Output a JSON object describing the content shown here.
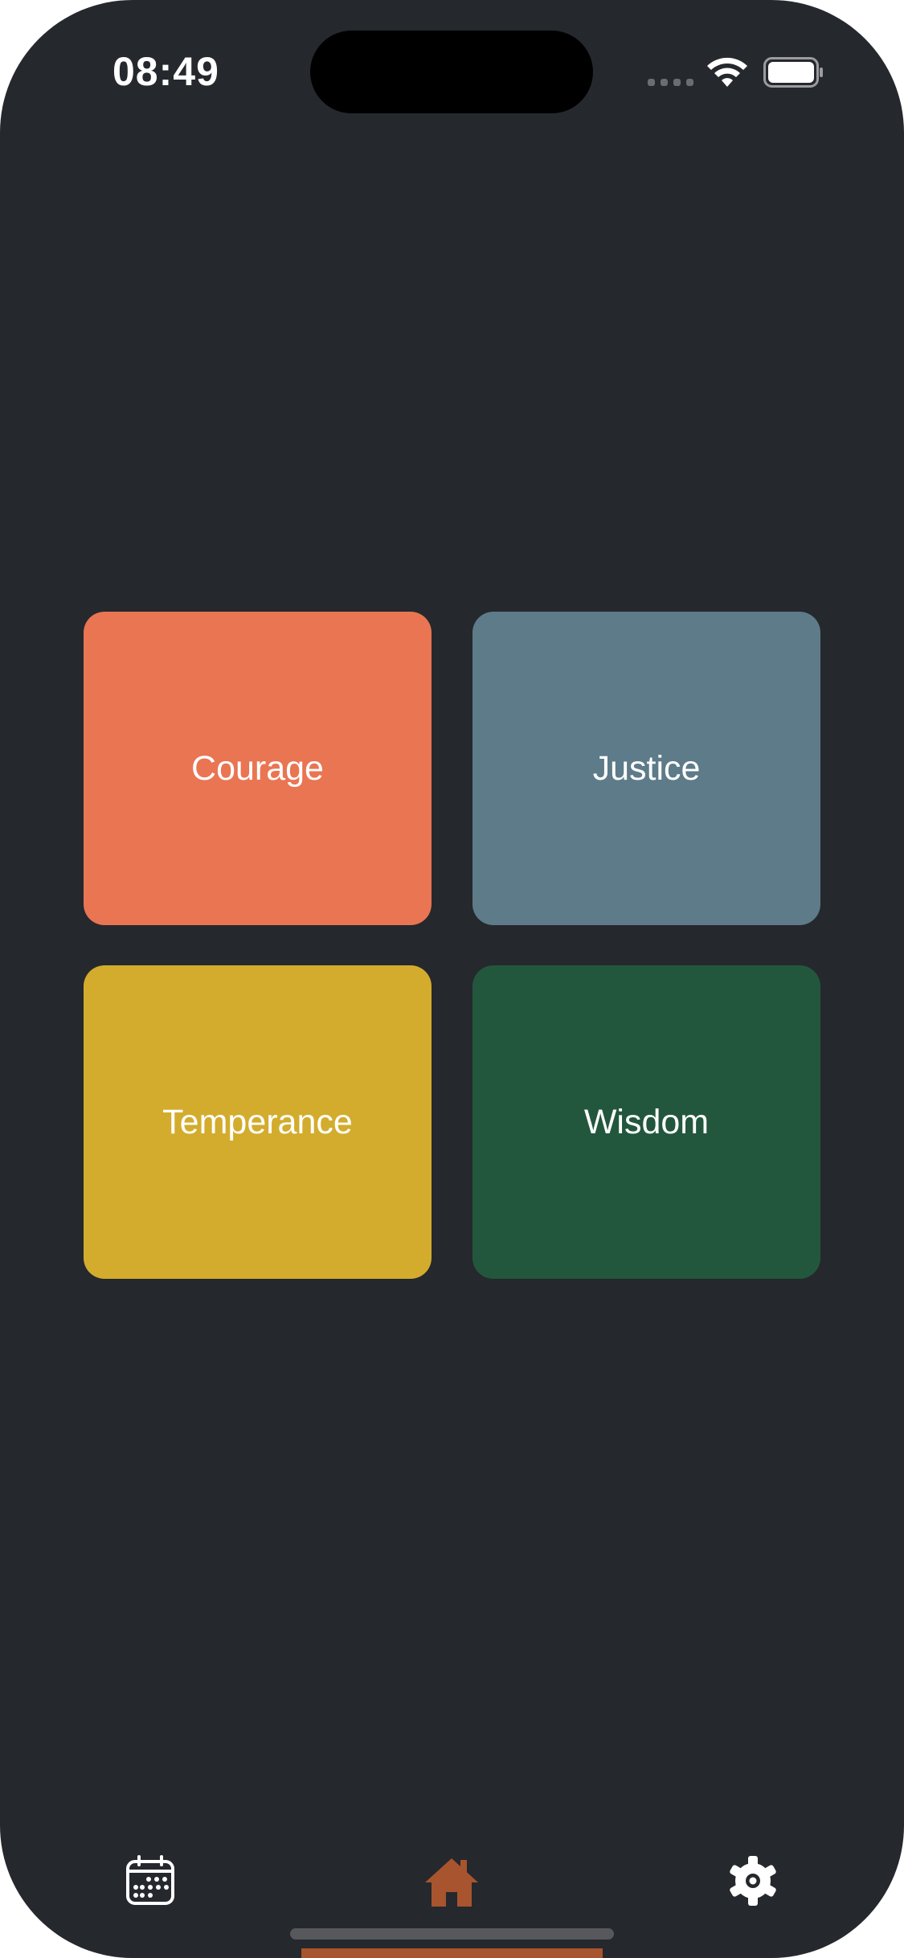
{
  "status_bar": {
    "time": "08:49"
  },
  "virtues": [
    {
      "label": "Courage",
      "color": "#e97553"
    },
    {
      "label": "Justice",
      "color": "#5e7b89"
    },
    {
      "label": "Temperance",
      "color": "#d3ac2d"
    },
    {
      "label": "Wisdom",
      "color": "#23573d"
    }
  ],
  "tab_bar": {
    "items": [
      {
        "icon": "calendar-icon",
        "active": false
      },
      {
        "icon": "home-icon",
        "active": true
      },
      {
        "icon": "gear-icon",
        "active": false
      }
    ],
    "active_color": "#a8542e",
    "inactive_color": "#ffffff"
  },
  "colors": {
    "background": "#25282d",
    "accent": "#a8542e"
  }
}
